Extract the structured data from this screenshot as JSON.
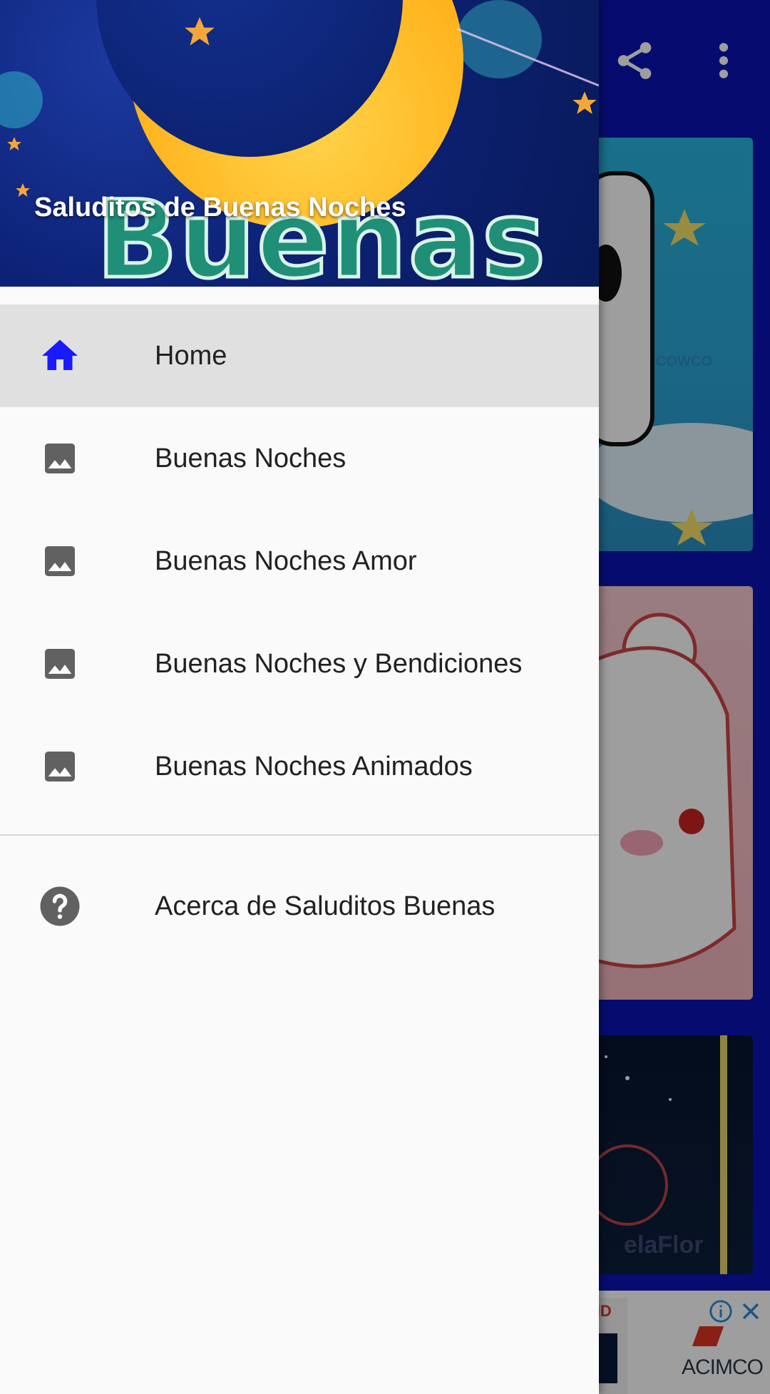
{
  "app": {
    "actions": {
      "share_icon": "share-icon",
      "more_icon": "more-vert-icon"
    },
    "ad": {
      "brand": "ACIMCO",
      "partial_text": "ND"
    },
    "colors": {
      "primary": "#0a14b4",
      "active_icon": "#1a1aff",
      "inactive_icon": "#616161"
    }
  },
  "drawer": {
    "header": {
      "title": "Saluditos de Buenas Noches",
      "art_word": "Buenas"
    },
    "items": [
      {
        "label": "Home",
        "icon": "home-icon",
        "active": true
      },
      {
        "label": "Buenas Noches",
        "icon": "image-icon",
        "active": false
      },
      {
        "label": "Buenas Noches Amor",
        "icon": "image-icon",
        "active": false
      },
      {
        "label": "Buenas Noches y Bendiciones",
        "icon": "image-icon",
        "active": false
      },
      {
        "label": "Buenas Noches Animados",
        "icon": "image-icon",
        "active": false
      }
    ],
    "footer_items": [
      {
        "label": "Acerca de Saluditos Buenas",
        "icon": "help-icon"
      }
    ]
  }
}
